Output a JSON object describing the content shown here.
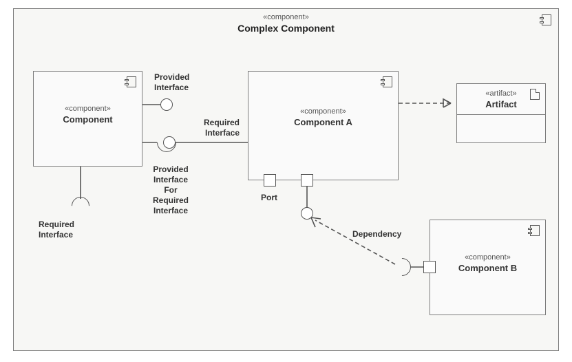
{
  "frame": {
    "stereotype": "«component»",
    "title": "Complex Component"
  },
  "comp1": {
    "stereotype": "«component»",
    "name": "Component"
  },
  "compA": {
    "stereotype": "«component»",
    "name": "Component A"
  },
  "compB": {
    "stereotype": "«component»",
    "name": "Component B"
  },
  "artifact": {
    "stereotype": "«artifact»",
    "name": "Artifact"
  },
  "labels": {
    "provided_interface": "Provided\nInterface",
    "required_interface_left": "Required\nInterface",
    "required_interface_mid": "Required\nInterface",
    "provided_for_required": "Provided\nInterface\nFor\nRequired\nInterface",
    "port": "Port",
    "dependency": "Dependency"
  }
}
